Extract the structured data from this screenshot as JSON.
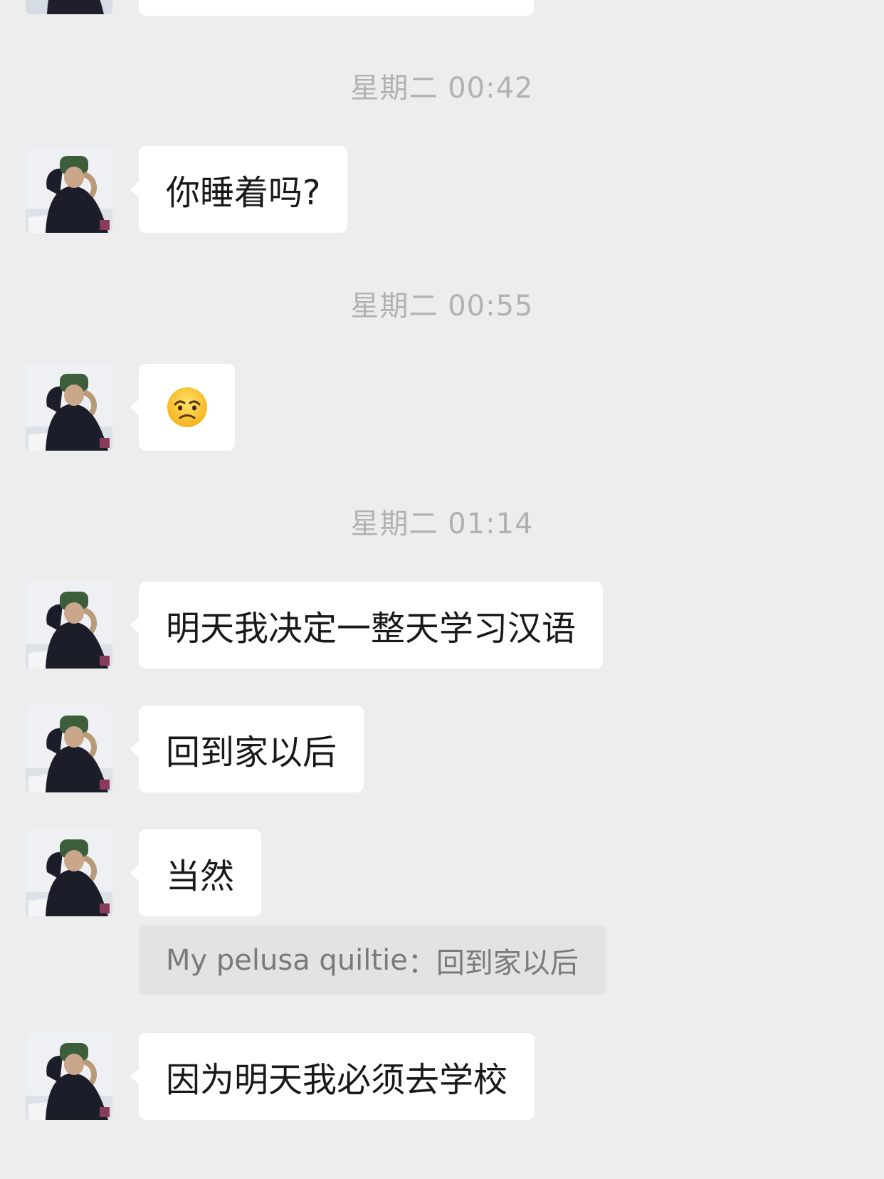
{
  "chat": {
    "timestamps": [
      "星期二 00:42",
      "星期二 00:55",
      "星期二 01:14"
    ],
    "messages": [
      {
        "type": "text",
        "text": "你睡着吗?"
      },
      {
        "type": "emoji",
        "icon": "disappointed-face-icon"
      },
      {
        "type": "text",
        "text": "明天我决定一整天学习汉语"
      },
      {
        "type": "text",
        "text": "回到家以后"
      },
      {
        "type": "text",
        "text": "当然"
      },
      {
        "type": "text",
        "text": "因为明天我必须去学校"
      }
    ],
    "quote": {
      "sender": "My pelusa quiltie",
      "separator": "：",
      "text": "回到家以后"
    }
  }
}
